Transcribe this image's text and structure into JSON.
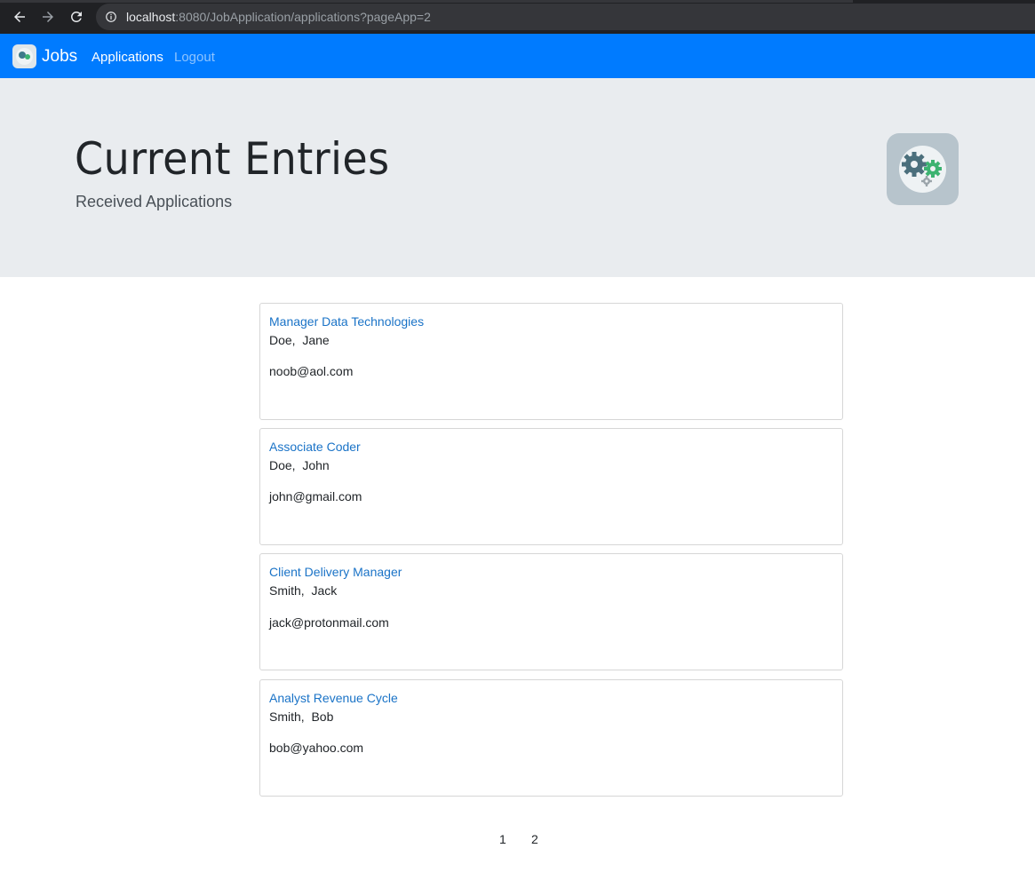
{
  "browser": {
    "url_host": "localhost",
    "url_rest": ":8080/JobApplication/applications?pageApp=2"
  },
  "navbar": {
    "brand": "Jobs",
    "links": [
      {
        "label": "Applications",
        "active": true
      },
      {
        "label": "Logout",
        "active": false
      }
    ]
  },
  "header": {
    "title": "Current Entries",
    "subtitle": "Received Applications",
    "icon": "gears-icon"
  },
  "applications": [
    {
      "position": "Manager Data Technologies",
      "name": "Doe,  Jane",
      "email": "noob@aol.com"
    },
    {
      "position": "Associate Coder",
      "name": "Doe,  John",
      "email": "john@gmail.com"
    },
    {
      "position": "Client Delivery Manager",
      "name": "Smith,  Jack",
      "email": "jack@protonmail.com"
    },
    {
      "position": "Analyst Revenue Cycle",
      "name": "Smith,  Bob",
      "email": "bob@yahoo.com"
    }
  ],
  "pagination": {
    "pages": [
      "1",
      "2"
    ]
  },
  "colors": {
    "navbar": "#007bff",
    "link": "#1a73c7",
    "jumbotron": "#e9ecef"
  }
}
